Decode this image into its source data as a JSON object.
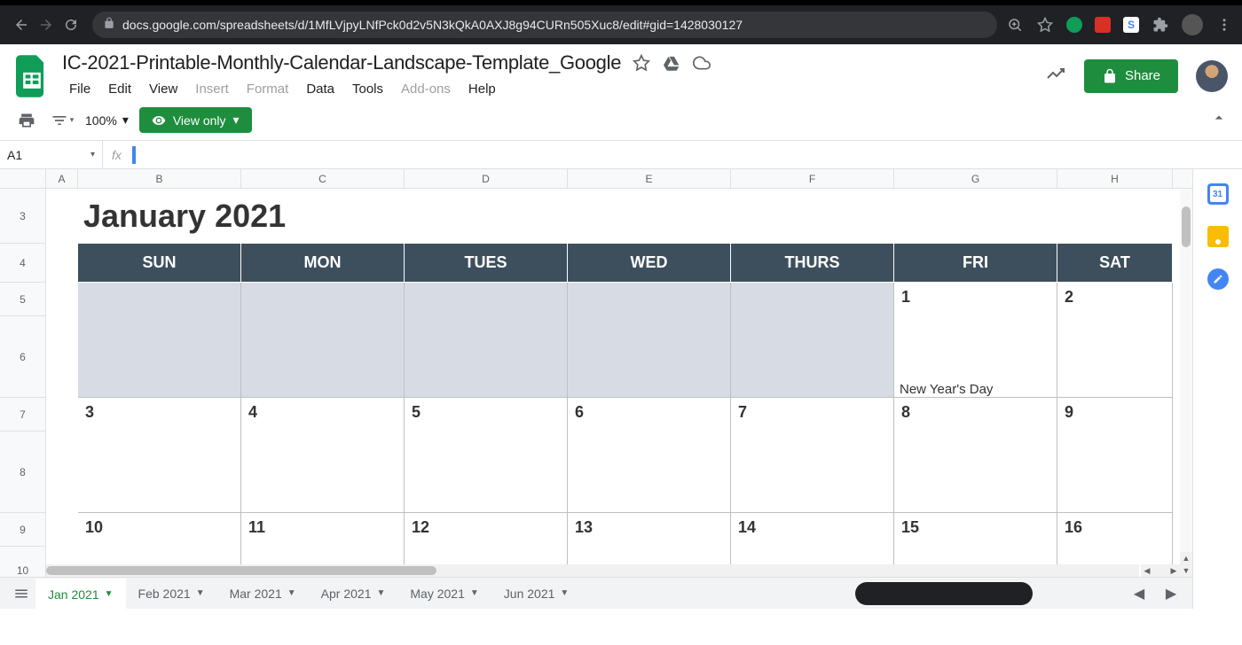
{
  "browser": {
    "url": "docs.google.com/spreadsheets/d/1MfLVjpyLNfPck0d2v5N3kQkA0AXJ8g94CURn505Xuc8/edit#gid=1428030127"
  },
  "header": {
    "doc_title": "IC-2021-Printable-Monthly-Calendar-Landscape-Template_Google",
    "share_label": "Share",
    "menus": [
      "File",
      "Edit",
      "View",
      "Insert",
      "Format",
      "Data",
      "Tools",
      "Add-ons",
      "Help"
    ],
    "menus_disabled": [
      false,
      false,
      false,
      true,
      true,
      false,
      false,
      true,
      false
    ]
  },
  "toolbar": {
    "zoom": "100%",
    "view_only": "View only"
  },
  "formula": {
    "cell_ref": "A1",
    "fx": "fx"
  },
  "columns": [
    "A",
    "B",
    "C",
    "D",
    "E",
    "F",
    "G",
    "H"
  ],
  "row_headers": [
    "3",
    "4",
    "5",
    "6",
    "7",
    "8",
    "9",
    "10"
  ],
  "calendar": {
    "title": "January 2021",
    "days": [
      "SUN",
      "MON",
      "TUES",
      "WED",
      "THURS",
      "FRI",
      "SAT"
    ],
    "week1": {
      "nums": [
        "",
        "",
        "",
        "",
        "",
        "1",
        "2"
      ],
      "inactive": [
        true,
        true,
        true,
        true,
        true,
        false,
        false
      ],
      "notes": [
        "",
        "",
        "",
        "",
        "",
        "New Year's Day",
        ""
      ]
    },
    "week2": {
      "nums": [
        "3",
        "4",
        "5",
        "6",
        "7",
        "8",
        "9"
      ],
      "notes": [
        "",
        "",
        "",
        "",
        "",
        "",
        ""
      ]
    },
    "week3": {
      "nums": [
        "10",
        "11",
        "12",
        "13",
        "14",
        "15",
        "16"
      ],
      "notes": [
        "",
        "",
        "",
        "",
        "",
        "",
        ""
      ]
    }
  },
  "sheet_tabs": [
    "Jan 2021",
    "Feb 2021",
    "Mar 2021",
    "Apr 2021",
    "May 2021",
    "Jun 2021"
  ],
  "active_tab": 0
}
